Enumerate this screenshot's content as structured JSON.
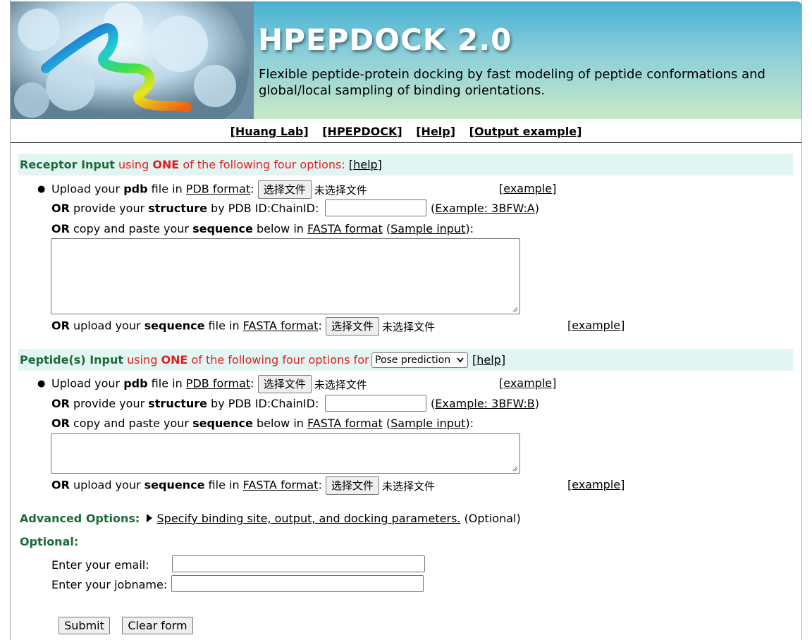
{
  "header": {
    "title": "HPEPDOCK 2.0",
    "subtitle": "Flexible peptide-protein docking by fast modeling of peptide conformations and global/local sampling of binding orientations."
  },
  "nav": {
    "huang_lab": "[Huang Lab]",
    "hpepdock": "[HPEPDOCK]",
    "help": "[Help]",
    "output_example": "[Output example]"
  },
  "receptor": {
    "title": "Receptor Input",
    "desc_prefix": "using ",
    "desc_one": "ONE",
    "desc_suffix": " of the following four options:",
    "help_open": "[",
    "help_link": "help",
    "help_close": "]",
    "upload_prefix": "Upload your ",
    "upload_bold": "pdb",
    "upload_mid": " file in ",
    "pdb_format": "PDB format",
    "colon": ":",
    "choose_file": "选择文件",
    "no_file": "未选择文件",
    "example": "example",
    "or": "OR",
    "provide": " provide your ",
    "structure": "structure",
    "by_pdb": " by PDB ID:ChainID:",
    "pdb_example": "Example: 3BFW:A",
    "copy": " copy and paste your ",
    "sequence": "sequence",
    "below_in": " below in ",
    "fasta_format": "FASTA format",
    "sample_input": "Sample input",
    "upload_seq": " upload your ",
    "file_in": " file in "
  },
  "peptide": {
    "title": "Peptide(s) Input",
    "desc_prefix": "using ",
    "desc_one": "ONE",
    "desc_suffix": " of the following four options for",
    "mode_selected": "Pose prediction",
    "pdb_example": "Example: 3BFW:B"
  },
  "advanced": {
    "label": "Advanced Options:",
    "link": "Specify binding site, output, and docking parameters.",
    "optional_note": "(Optional)"
  },
  "optional": {
    "label": "Optional:",
    "email_label": "Enter your email:",
    "email_value": "",
    "jobname_label": "Enter your jobname:",
    "jobname_value": ""
  },
  "actions": {
    "submit": "Submit",
    "clear": "Clear form"
  }
}
